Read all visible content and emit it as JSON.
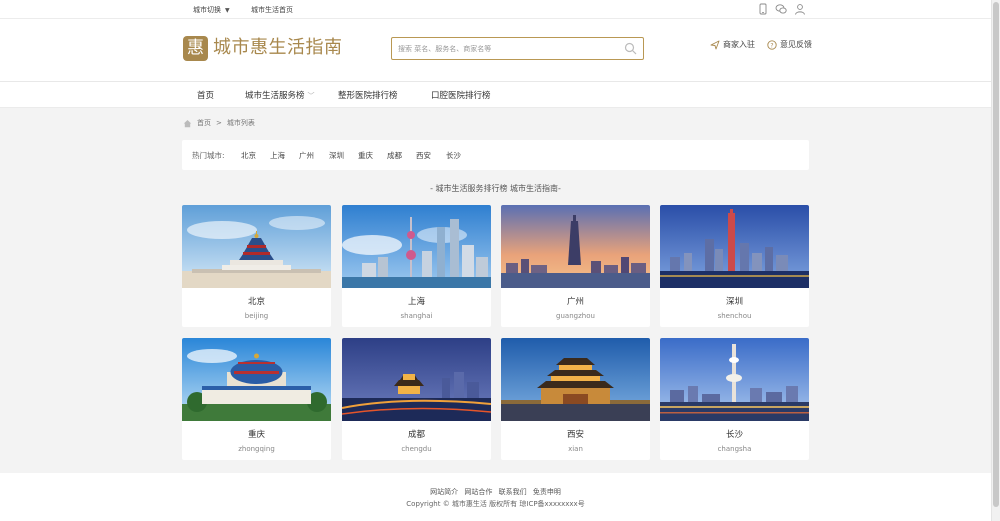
{
  "topbar": {
    "city_switch": "城市切换",
    "home_link": "城市生活首页",
    "icons": [
      "mobile-icon",
      "wechat-icon",
      "user-icon"
    ]
  },
  "header": {
    "logo_char": "惠",
    "site_name": "城市惠生活指南",
    "search_placeholder": "搜索 菜名、服务名、商家名等",
    "merchant_join": "商家入驻",
    "feedback": "意见反馈"
  },
  "nav": {
    "items": [
      "首页",
      "城市生活服务榜",
      "整形医院排行榜",
      "口腔医院排行榜"
    ]
  },
  "breadcrumb": {
    "home": "首页",
    "separator": ">",
    "current": "城市列表"
  },
  "hot_cities": {
    "label": "热门城市:",
    "cities": [
      "北京",
      "上海",
      "广州",
      "深圳",
      "重庆",
      "成都",
      "西安",
      "长沙"
    ]
  },
  "section_title": "- 城市生活服务排行榜 城市生活指南-",
  "cards": [
    {
      "name": "北京",
      "pinyin": "beijing"
    },
    {
      "name": "上海",
      "pinyin": "shanghai"
    },
    {
      "name": "广州",
      "pinyin": "guangzhou"
    },
    {
      "name": "深圳",
      "pinyin": "shenchou"
    },
    {
      "name": "重庆",
      "pinyin": "zhongqing"
    },
    {
      "name": "成都",
      "pinyin": "chengdu"
    },
    {
      "name": "西安",
      "pinyin": "xian"
    },
    {
      "name": "长沙",
      "pinyin": "changsha"
    }
  ],
  "footer": {
    "links": [
      "网站简介",
      "网站合作",
      "联系我们",
      "免责申明"
    ],
    "copyright": "Copyright © 城市惠生活 版权所有 琼ICP备xxxxxxxx号"
  },
  "colors": {
    "brand": "#a8884d",
    "search_border": "#b99853",
    "background": "#f3f3f3"
  }
}
